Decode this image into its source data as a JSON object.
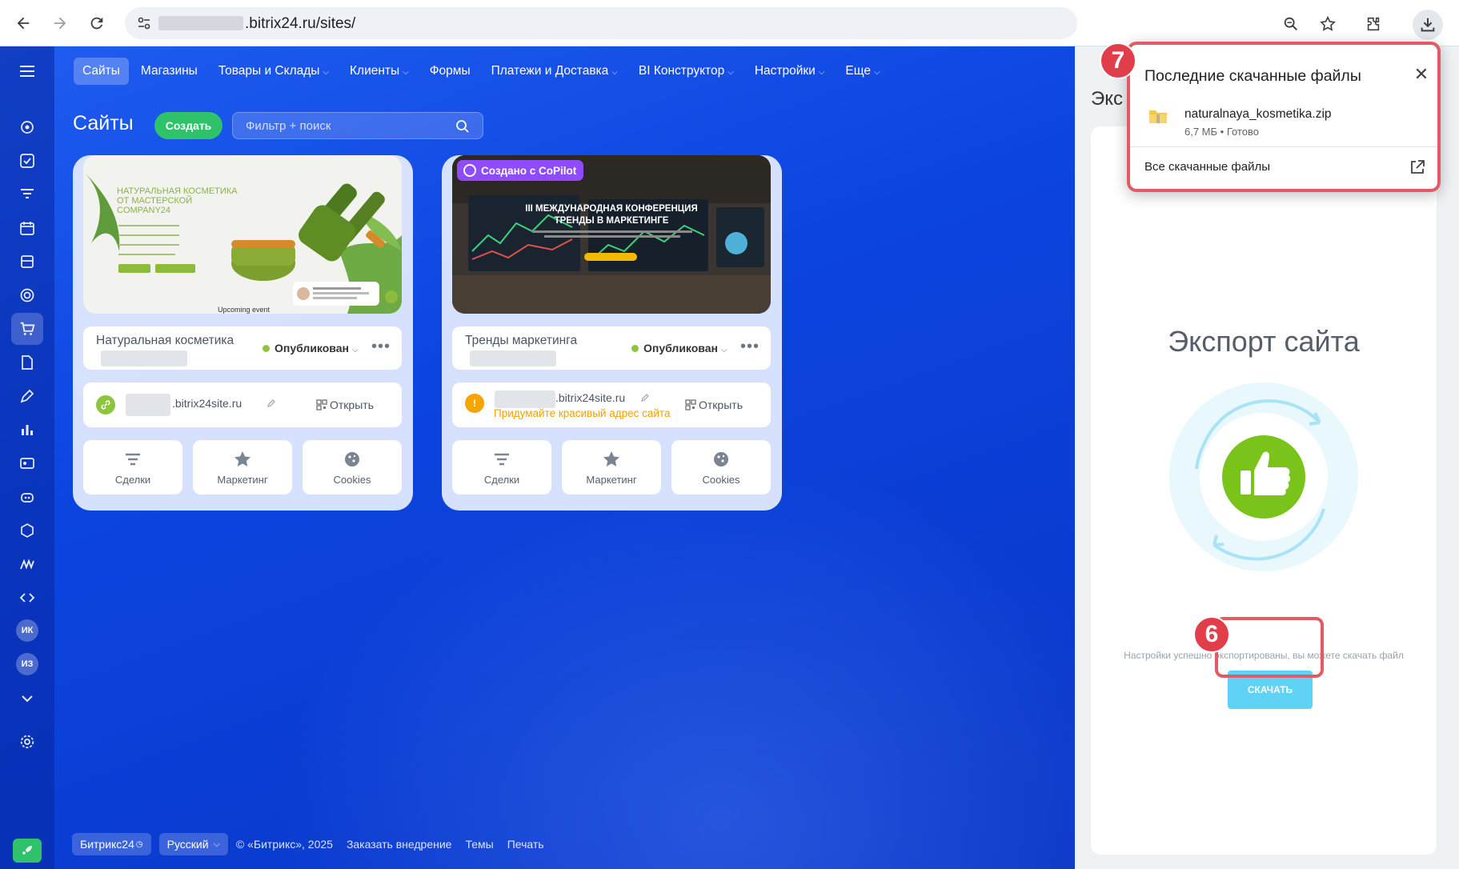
{
  "browser": {
    "url": ".bitrix24.ru/sites/",
    "back_icon": "arrow-left-icon",
    "forward_icon": "arrow-right-icon",
    "reload_icon": "reload-icon"
  },
  "top_menu": [
    {
      "label": "Сайты",
      "active": true,
      "has_caret": false
    },
    {
      "label": "Магазины",
      "active": false,
      "has_caret": false
    },
    {
      "label": "Товары и Склады",
      "active": false,
      "has_caret": true
    },
    {
      "label": "Клиенты",
      "active": false,
      "has_caret": true
    },
    {
      "label": "Формы",
      "active": false,
      "has_caret": false
    },
    {
      "label": "Платежи и Доставка",
      "active": false,
      "has_caret": true
    },
    {
      "label": "BI Конструктор",
      "active": false,
      "has_caret": true
    },
    {
      "label": "Настройки",
      "active": false,
      "has_caret": true
    },
    {
      "label": "Еще",
      "active": false,
      "has_caret": true
    }
  ],
  "rail": {
    "avatars": [
      "ИК",
      "ИЗ"
    ]
  },
  "page": {
    "title": "Сайты",
    "create_label": "Создать",
    "filter_placeholder": "Фильтр + поиск"
  },
  "cards": [
    {
      "name": "Натуральная косметика",
      "status": "Опубликован",
      "domain": ".bitrix24site.ru",
      "domain_warning": "",
      "url_status": "ok",
      "open_label": "Открыть",
      "preview": {
        "headline_lines": [
          "НАТУРАЛЬНАЯ КОСМЕТИКА",
          "ОТ МАСТЕРСКОЙ",
          "COMPANY24"
        ],
        "footer": "Upcoming event",
        "badge": ""
      },
      "tiles": [
        "Сделки",
        "Маркетинг",
        "Cookies"
      ]
    },
    {
      "name": "Тренды маркетинга",
      "status": "Опубликован",
      "domain": ".bitrix24site.ru",
      "domain_warning": "Придумайте красивый адрес сайта",
      "url_status": "warning",
      "open_label": "Открыть",
      "preview": {
        "headline_lines": [
          "III МЕЖДУНАРОДНАЯ КОНФЕРЕНЦИЯ",
          "ТРЕНДЫ В МАРКЕТИНГЕ"
        ],
        "footer": "",
        "badge": "Создано с CoPilot"
      },
      "tiles": [
        "Сделки",
        "Маркетинг",
        "Cookies"
      ]
    }
  ],
  "footer": {
    "brand": "Битрикс24",
    "language": "Русский",
    "links": [
      "© «Битрикс», 2025",
      "Заказать внедрение",
      "Темы",
      "Печать"
    ]
  },
  "slider": {
    "header": "Экс",
    "export_title": "Экспорт сайта",
    "message": "Настройки успешно экспортированы, вы можете скачать файл",
    "download_label": "СКАЧАТЬ"
  },
  "downloads": {
    "title": "Последние скачанные файлы",
    "file_name": "naturalnaya_kosmetika.zip",
    "file_meta": "6,7 МБ • Готово",
    "all_label": "Все скачанные файлы"
  },
  "steps": [
    "6",
    "7"
  ],
  "colors": {
    "accent_green": "#2fc26b",
    "page_blue": "#0c44e0",
    "highlight_red": "#e25a65",
    "download_cyan": "#5fd3f5",
    "warning_orange": "#f2a100"
  }
}
